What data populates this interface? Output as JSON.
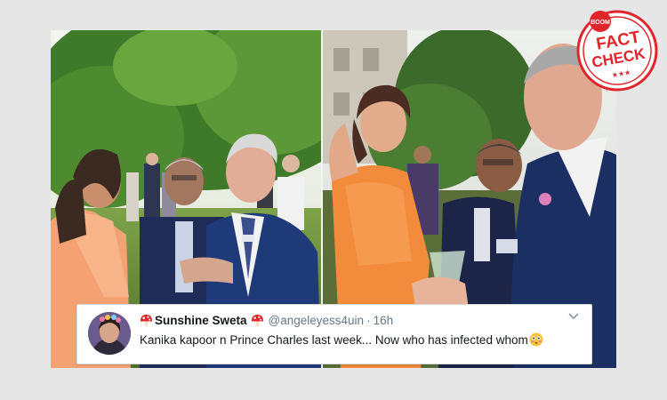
{
  "tweet": {
    "display_name": "Sunshine Sweta",
    "handle": "@angeleyess4uin",
    "separator": "·",
    "time": "16h",
    "text": "Kanika kapoor n Prince Charles last week... Now who has infected whom",
    "emoji_name_left": "mushroom-emoji",
    "emoji_name_right": "mushroom-emoji",
    "text_emoji": "flushed-face-emoji",
    "menu_icon": "chevron-down-icon"
  },
  "stamp": {
    "brand": "BOOM",
    "line1": "FACT",
    "line2": "CHECK",
    "stars": "★★★",
    "color": "#e0252b"
  },
  "photos": {
    "left": "garden-party-photo-left",
    "right": "garden-party-photo-right"
  },
  "colors": {
    "background": "#e6e6e6",
    "tweet_text": "#14171a",
    "tweet_meta": "#657786"
  }
}
